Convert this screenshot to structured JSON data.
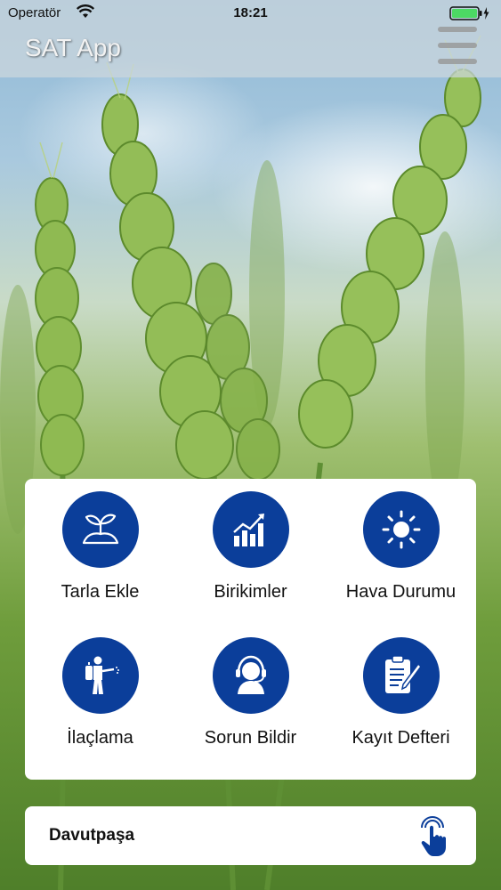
{
  "status_bar": {
    "carrier": "Operatör",
    "time": "18:21"
  },
  "nav": {
    "title": "SAT App",
    "menu_icon": "hamburger-menu-icon"
  },
  "colors": {
    "accent": "#0b3e9a",
    "battery": "#4cd964"
  },
  "menu_tiles": [
    {
      "label": "Tarla Ekle",
      "icon": "plant-sprout-icon"
    },
    {
      "label": "Birikimler",
      "icon": "growth-chart-icon"
    },
    {
      "label": "Hava Durumu",
      "icon": "sun-icon"
    },
    {
      "label": "İlaçlama",
      "icon": "sprayer-person-icon"
    },
    {
      "label": "Sorun Bildir",
      "icon": "support-headset-icon"
    },
    {
      "label": "Kayıt Defteri",
      "icon": "clipboard-pen-icon"
    }
  ],
  "location": {
    "name": "Davutpaşa",
    "icon": "tap-hand-icon"
  }
}
